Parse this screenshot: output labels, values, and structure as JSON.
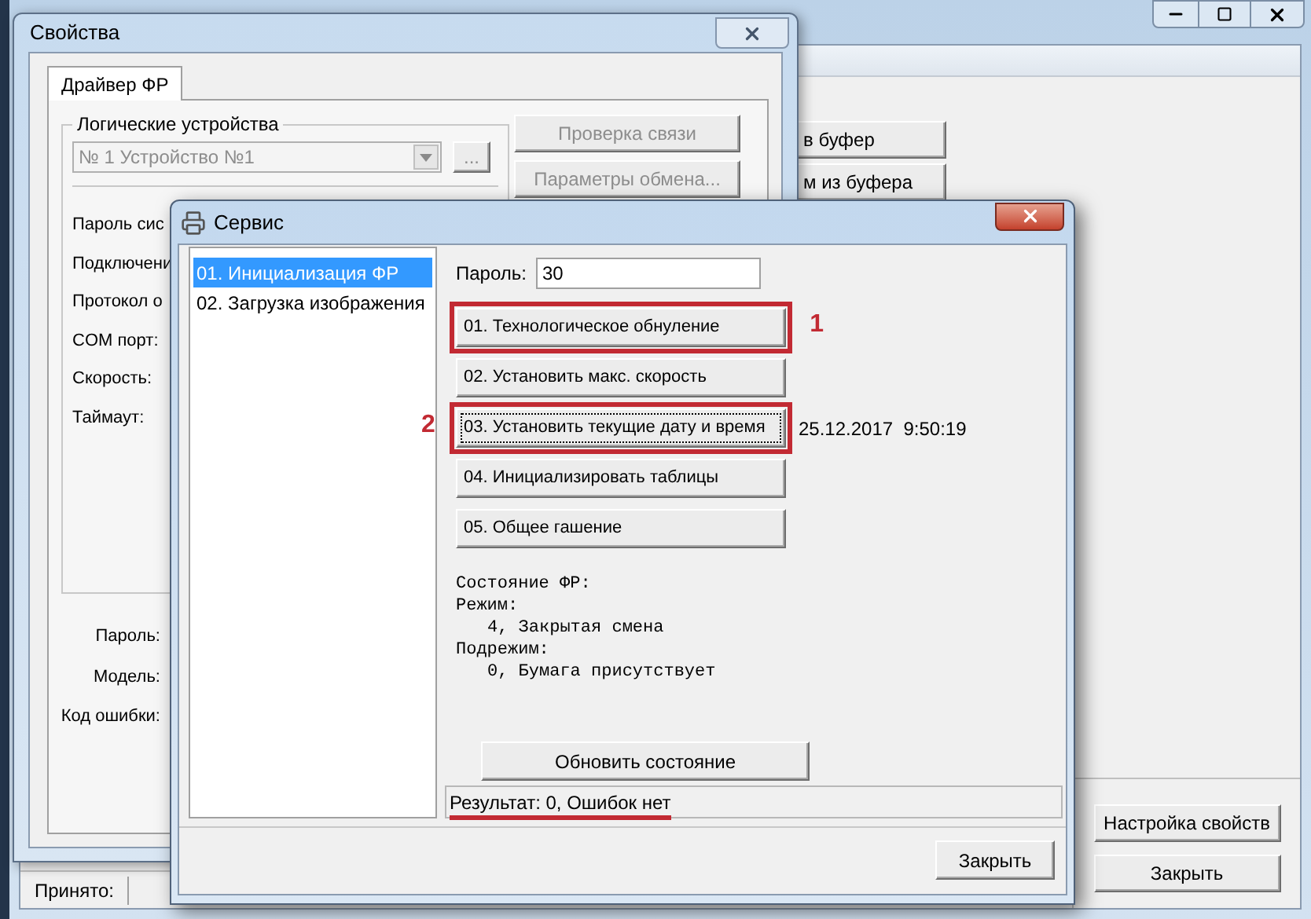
{
  "main_window": {
    "top_buttons": [
      "в буфер",
      "м из буфера"
    ],
    "bottom_buttons": [
      "Настройка свойств",
      "Закрыть"
    ],
    "status_label": "Принято:"
  },
  "properties_window": {
    "title": "Свойства",
    "tabs": [
      {
        "label": "Драйвер ФР",
        "selected": true
      }
    ],
    "group_label": "Логические устройства",
    "device_select": {
      "value": "№ 1 Устройство №1",
      "disabled": true
    },
    "browse_button": {
      "label": "...",
      "disabled": true
    },
    "side_buttons": [
      {
        "label": "Проверка связи",
        "disabled": true
      },
      {
        "label": "Параметры обмена...",
        "disabled": true
      }
    ],
    "field_labels": [
      "Пароль сис",
      "Подключени",
      "Протокол о",
      "COM порт:",
      "Скорость:",
      "Таймаут:"
    ],
    "bottom_labels": [
      "Пароль:",
      "Модель:",
      "Код ошибки:"
    ]
  },
  "service_dialog": {
    "title": "Сервис",
    "list": [
      {
        "label": "01. Инициализация ФР",
        "selected": true
      },
      {
        "label": "02. Загрузка изображения",
        "selected": false
      }
    ],
    "password": {
      "label": "Пароль:",
      "value": "30"
    },
    "actions": [
      {
        "label": "01. Технологическое обнуление",
        "focused": false,
        "annotation_after": "1"
      },
      {
        "label": "02. Установить макс. скорость",
        "focused": false
      },
      {
        "label": "03. Установить текущие дату и время",
        "focused": true,
        "annotation_before": "2",
        "note": "25.12.2017  9:50:19"
      },
      {
        "label": "04. Инициализировать таблицы",
        "focused": false
      },
      {
        "label": "05. Общее гашение",
        "focused": false
      }
    ],
    "status_lines": [
      {
        "text": "Состояние ФР:",
        "kind": "label"
      },
      {
        "text": "Режим:",
        "kind": "label"
      },
      {
        "text": "4, Закрытая смена",
        "kind": "value"
      },
      {
        "text": "Подрежим:",
        "kind": "label"
      },
      {
        "text": "0, Бумага присутствует",
        "kind": "value"
      }
    ],
    "refresh_button": "Обновить состояние",
    "result": {
      "text": "Результат: 0, Ошибок нет",
      "underlined": true
    },
    "close_button": "Закрыть"
  }
}
